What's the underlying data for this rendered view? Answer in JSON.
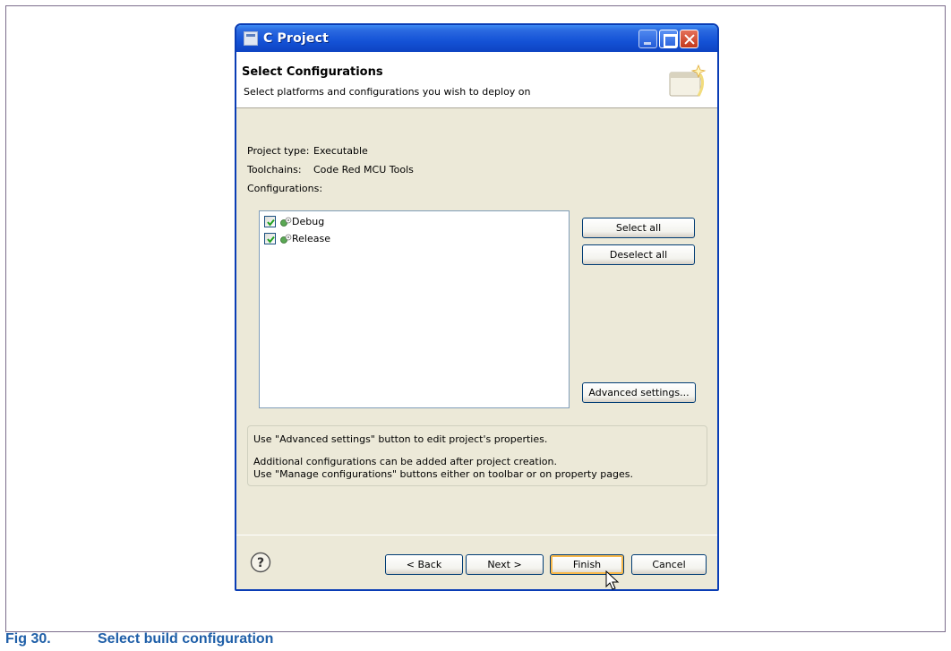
{
  "window": {
    "title": "C Project"
  },
  "header": {
    "title": "Select Configurations",
    "description": "Select platforms and configurations you wish to deploy on"
  },
  "project": {
    "type_label": "Project type:",
    "type_value": "Executable",
    "toolchains_label": "Toolchains:",
    "toolchains_value": "Code Red MCU Tools",
    "configurations_label": "Configurations:"
  },
  "configurations": [
    {
      "label": "Debug",
      "checked": true
    },
    {
      "label": "Release",
      "checked": true
    }
  ],
  "side_buttons": {
    "select_all": "Select all",
    "deselect_all": "Deselect all",
    "advanced_settings": "Advanced settings..."
  },
  "info": {
    "line1": "Use \"Advanced settings\" button to edit project's properties.",
    "line2": "Additional configurations can be added after project creation.",
    "line3": "Use \"Manage configurations\" buttons either on toolbar or on property pages."
  },
  "footer": {
    "back": "< Back",
    "next": "Next >",
    "finish": "Finish",
    "cancel": "Cancel"
  },
  "caption": {
    "number": "Fig 30.",
    "text": "Select build configuration"
  },
  "colors": {
    "titlebar": "#1452d6",
    "dialog_bg": "#ece9d8",
    "caption": "#1f5fa8",
    "default_button_highlight": "#f8b84a"
  },
  "icons": {
    "window": "window-icon",
    "wizard": "wizard-banner-icon",
    "config": "configuration-gear-icon",
    "help": "help-icon",
    "cursor": "mouse-cursor-icon"
  }
}
